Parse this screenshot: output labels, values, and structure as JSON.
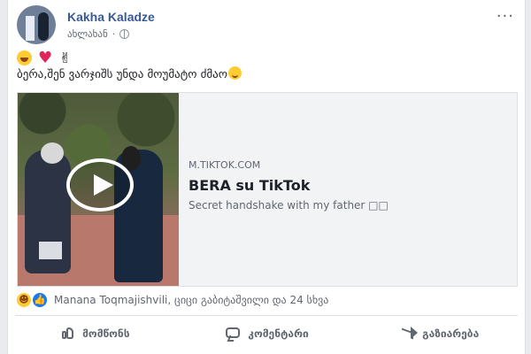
{
  "post": {
    "author": "Kakha Kaladze",
    "time": "ახლახან",
    "text": "ბერა,შენ ვარჯიშს უნდა მოუმატო ძმაო",
    "more_label": "···"
  },
  "link": {
    "domain": "M.TIKTOK.COM",
    "title": "BERA su TikTok",
    "description": "Secret handshake with my father □□"
  },
  "reactions": {
    "text": "Manana Toqmajishvili, ციცი გაბიტაშვილი და 24 სხვა"
  },
  "actions": [
    {
      "label": "მომწონს"
    },
    {
      "label": "კომენტარი"
    },
    {
      "label": "გაზიარება"
    }
  ],
  "colors": {
    "author": "#385898",
    "background": "#e9ebee",
    "card": "#f2f3f5",
    "like": "#1877f2"
  }
}
